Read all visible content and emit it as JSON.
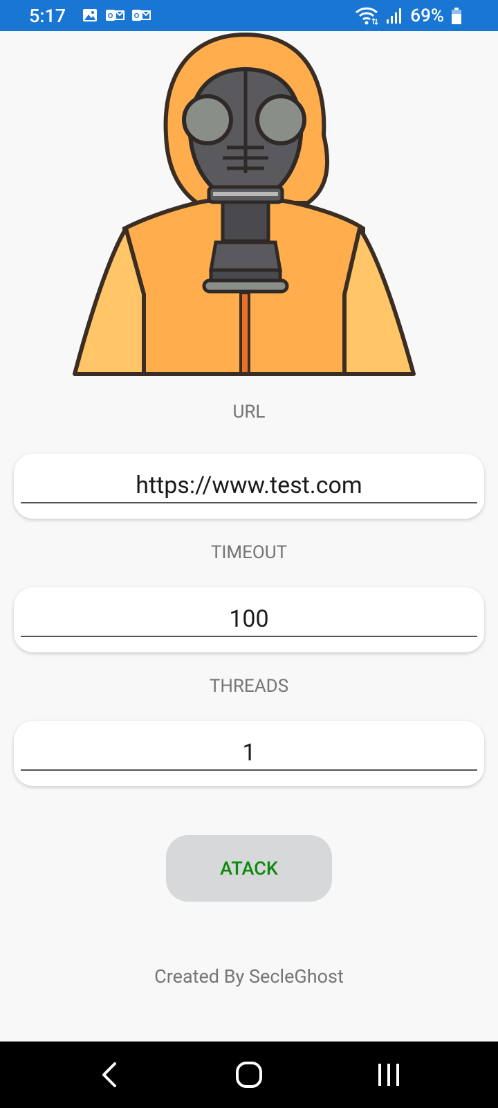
{
  "status_bar": {
    "time": "5:17",
    "battery_percent": "69%",
    "left_icons": [
      "image-icon",
      "outlook-icon",
      "outlook-icon"
    ],
    "right_icons": [
      "wifi-icon",
      "signal-icon",
      "battery-icon"
    ],
    "background_color": "#1976d2"
  },
  "form": {
    "url_label": "URL",
    "url_value": "https://www.test.com",
    "timeout_label": "TIMEOUT",
    "timeout_value": "100",
    "threads_label": "THREADS",
    "threads_value": "1"
  },
  "action": {
    "button_label": "ATACK",
    "button_text_color": "#0b8a0b"
  },
  "footer": {
    "credits": "Created By SecleGhost"
  },
  "nav_bar": {
    "icons": [
      "back-icon",
      "home-icon",
      "recents-icon"
    ]
  }
}
